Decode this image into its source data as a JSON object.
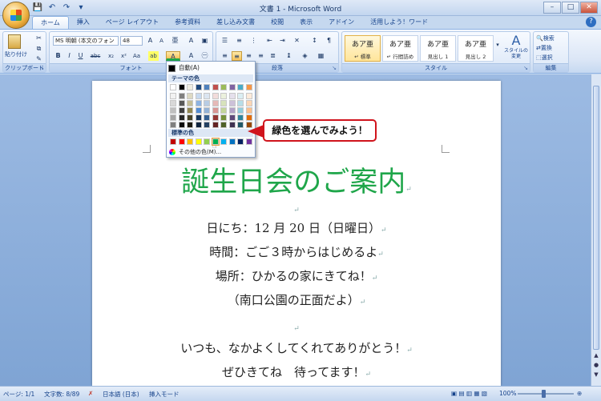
{
  "window": {
    "title": "文書 1 - Microsoft Word"
  },
  "qat": {
    "save_icon": "💾",
    "undo_icon": "↶",
    "redo_icon": "↷",
    "more_icon": "▾"
  },
  "window_controls": {
    "minimize": "–",
    "maximize": "□",
    "close": "✕"
  },
  "tabs": [
    "ホーム",
    "挿入",
    "ページ レイアウト",
    "参考資料",
    "差し込み文書",
    "校閲",
    "表示",
    "アドイン",
    "活用しよう！ワード"
  ],
  "help": "?",
  "ribbon": {
    "clipboard": {
      "label": "クリップボード",
      "paste": "貼り付け"
    },
    "font": {
      "label": "フォント",
      "font_name": "MS 明朝 (本文のフォン",
      "font_size": "48",
      "bold": "B",
      "italic": "I",
      "underline": "U",
      "strike": "abc",
      "subscript": "x₂",
      "superscript": "x²",
      "case": "Aa",
      "highlight": "ab",
      "font_color": "A",
      "grow": "A",
      "shrink": "A",
      "clear": "A"
    },
    "paragraph": {
      "label": "段落"
    },
    "styles": {
      "label": "スタイル",
      "items": [
        {
          "sample": "あア亜",
          "name": "↵ 標準"
        },
        {
          "sample": "あア亜",
          "name": "↵ 行間詰め"
        },
        {
          "sample": "あア亜",
          "name": "見出し 1"
        },
        {
          "sample": "あア亜",
          "name": "見出し 2"
        }
      ],
      "change_styles": "スタイルの変更"
    },
    "editing": {
      "label": "編集",
      "find": "検索",
      "replace": "置換",
      "select": "選択"
    }
  },
  "color_menu": {
    "auto": "自動(A)",
    "theme_header": "テーマの色",
    "standard_header": "標準の色",
    "more": "その他の色(M)...",
    "theme_top": [
      "#ffffff",
      "#000000",
      "#eeece1",
      "#1f497d",
      "#4f81bd",
      "#c0504d",
      "#9bbb59",
      "#8064a2",
      "#4bacc6",
      "#f79646"
    ],
    "theme_shades": [
      [
        "#f2f2f2",
        "#7f7f7f",
        "#ddd9c3",
        "#c6d9f0",
        "#dbe5f1",
        "#f2dcdb",
        "#ebf1dd",
        "#e5e0ec",
        "#dbeef3",
        "#fdeada"
      ],
      [
        "#d8d8d8",
        "#595959",
        "#c4bd97",
        "#8db3e2",
        "#b8cce4",
        "#e5b9b7",
        "#d7e3bc",
        "#ccc1d9",
        "#b7dde8",
        "#fbd5b5"
      ],
      [
        "#bfbfbf",
        "#3f3f3f",
        "#938953",
        "#548dd4",
        "#95b3d7",
        "#d99694",
        "#c3d69b",
        "#b2a2c7",
        "#92cddc",
        "#fac08f"
      ],
      [
        "#a5a5a5",
        "#262626",
        "#494429",
        "#17365d",
        "#366092",
        "#953734",
        "#76923c",
        "#5f497a",
        "#31859b",
        "#e36c09"
      ],
      [
        "#7f7f7f",
        "#0c0c0c",
        "#1d1b10",
        "#0f243e",
        "#244061",
        "#632423",
        "#4f6128",
        "#3f3151",
        "#205867",
        "#974806"
      ]
    ],
    "standard": [
      "#c00000",
      "#ff0000",
      "#ffc000",
      "#ffff00",
      "#92d050",
      "#00b050",
      "#00b0f0",
      "#0070c0",
      "#002060",
      "#7030a0"
    ]
  },
  "callout": {
    "text": "緑色を選んでみよう！"
  },
  "document": {
    "title": "誕生日会のご案内",
    "lines": [
      "日にち：12 月 20 日（日曜日）",
      "時間：ごご３時からはじめるよ",
      "場所：ひかるの家にきてね！",
      "（南口公園の正面だよ）",
      "いつも、なかよくしてくれてありがとう！",
      "ぜひきてね　待ってます！"
    ],
    "title_color": "#1fa64a",
    "return_mark": "↵"
  },
  "status": {
    "page": "ページ: 1/1",
    "words": "文字数: 8/89",
    "lang": "日本語 (日本)",
    "mode": "挿入モード",
    "zoom": "100%"
  }
}
